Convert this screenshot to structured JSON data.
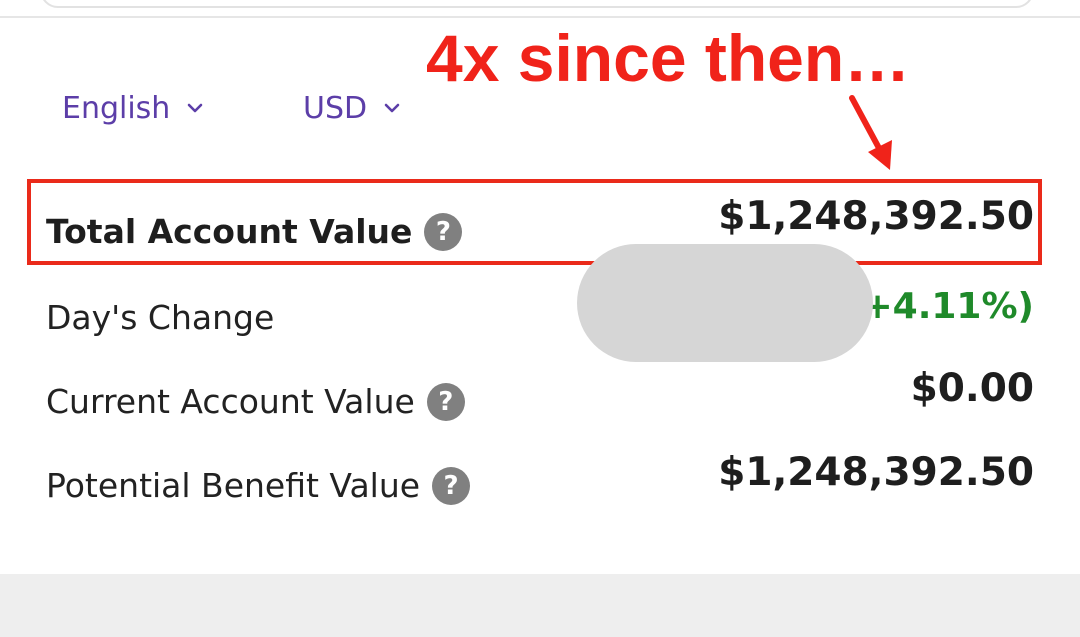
{
  "annotation": {
    "text": "4x since then…",
    "color": "#f0231a"
  },
  "selectors": {
    "language": "English",
    "currency": "USD"
  },
  "rows": [
    {
      "label": "Total Account Value",
      "value": "$1,248,392.50",
      "has_help": true,
      "highlighted": true
    },
    {
      "label": "Day's Change",
      "value": "(+4.11%)",
      "has_help": false,
      "value_color": "#1f8a2a"
    },
    {
      "label": "Current Account Value",
      "value": "$0.00",
      "has_help": true
    },
    {
      "label": "Potential Benefit Value",
      "value": "$1,248,392.50",
      "has_help": true
    }
  ],
  "icons": {
    "help": "?"
  },
  "colors": {
    "accent": "#5c3ea8",
    "positive": "#1f8a2a",
    "highlight_border": "#ea2a1a"
  }
}
